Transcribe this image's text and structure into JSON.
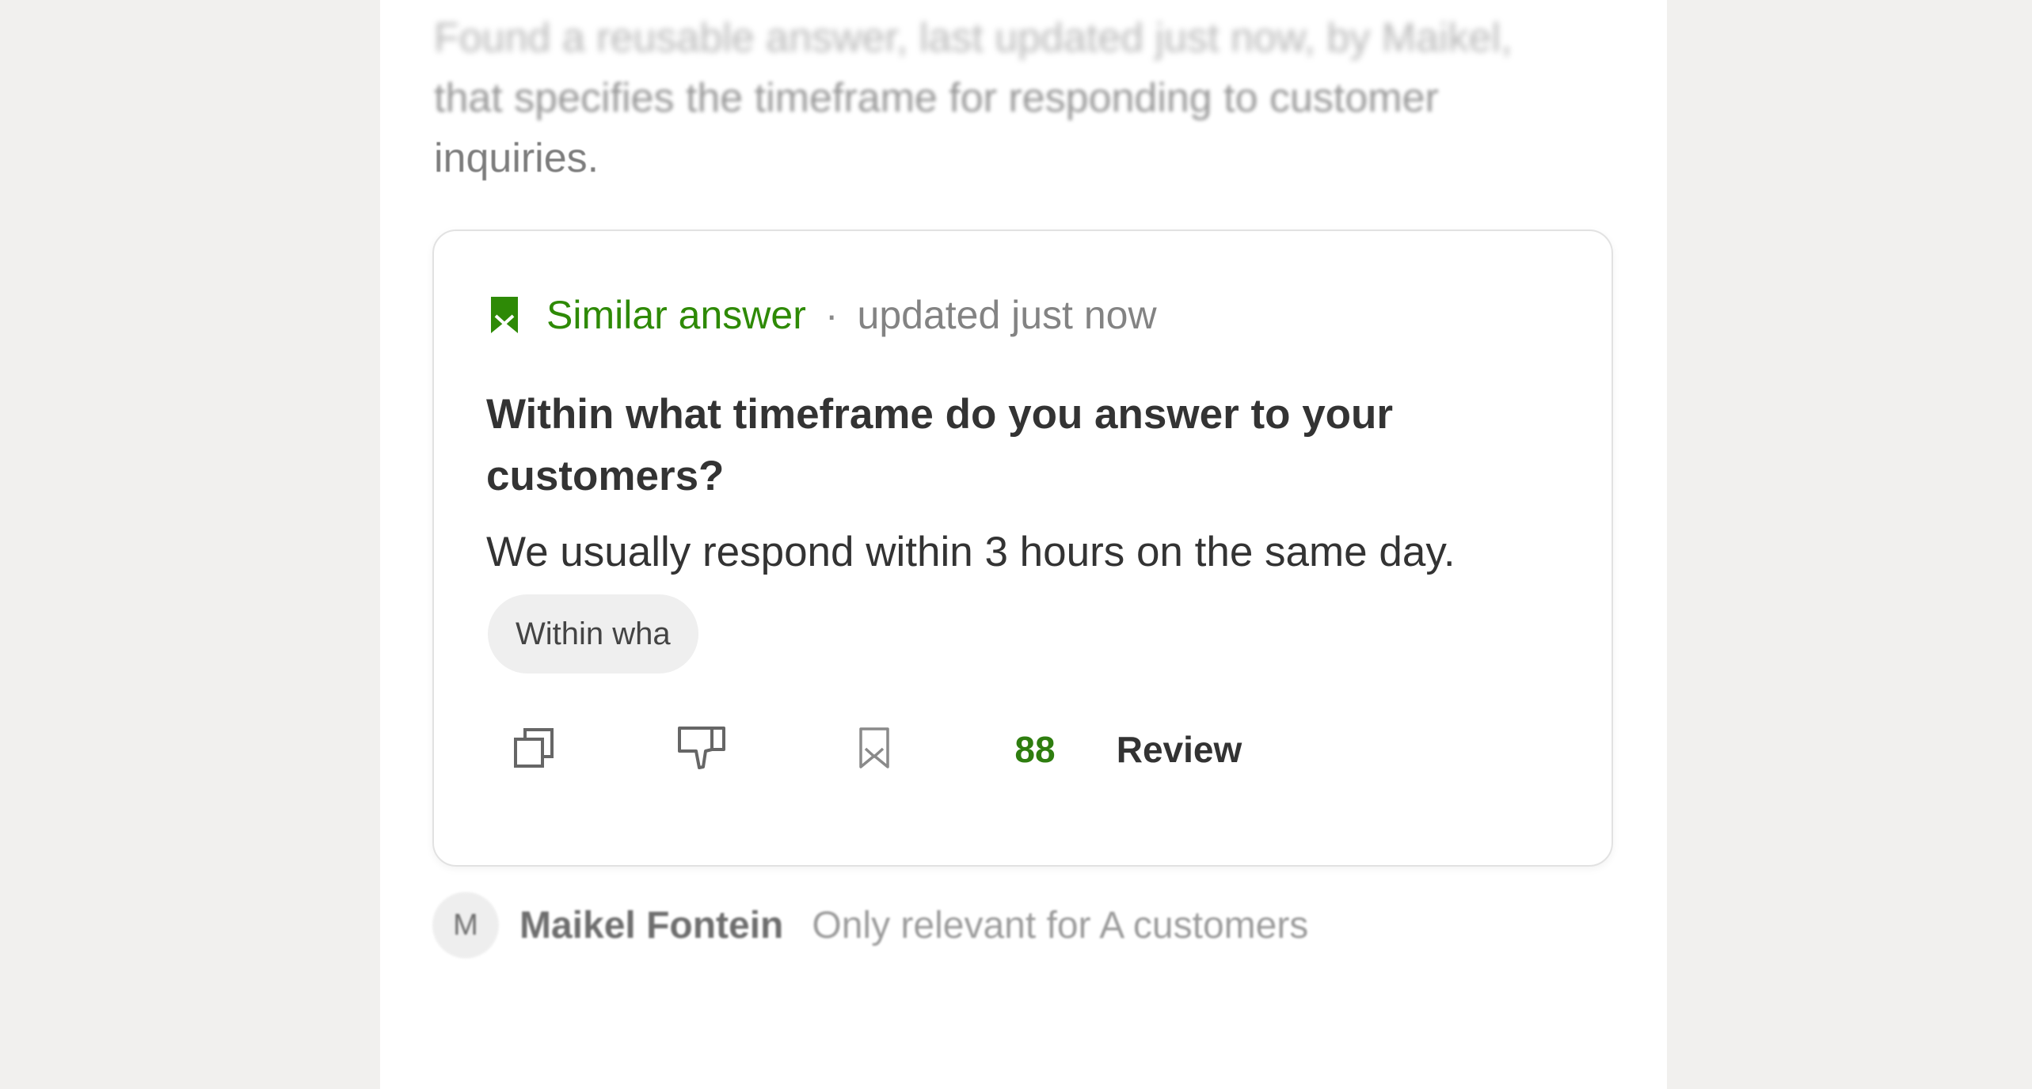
{
  "intro": {
    "line1": "Found a reusable answer, last updated just now, by Maikel,",
    "line2": "that specifies the timeframe for responding to customer",
    "line3": "inquiries."
  },
  "card": {
    "header": {
      "icon": "bookmark-filled-icon",
      "label": "Similar answer",
      "separator": "·",
      "updated": "updated just now"
    },
    "question": "Within what timeframe do you answer to your customers?",
    "answer": "We usually respond within 3 hours on the same day.",
    "chip": "Within wha",
    "actions": {
      "copy_icon": "copy-icon",
      "dislike_icon": "thumbs-down-icon",
      "save_icon": "bookmark-outline-icon",
      "score": "88",
      "review_label": "Review"
    }
  },
  "footer": {
    "avatar_initial": "M",
    "author": "Maikel Fontein",
    "note": "Only relevant for A customers"
  },
  "colors": {
    "accent_green": "#2e8a06",
    "score_green": "#2e7d0f",
    "background": "#f1f0ee",
    "panel": "#ffffff"
  }
}
